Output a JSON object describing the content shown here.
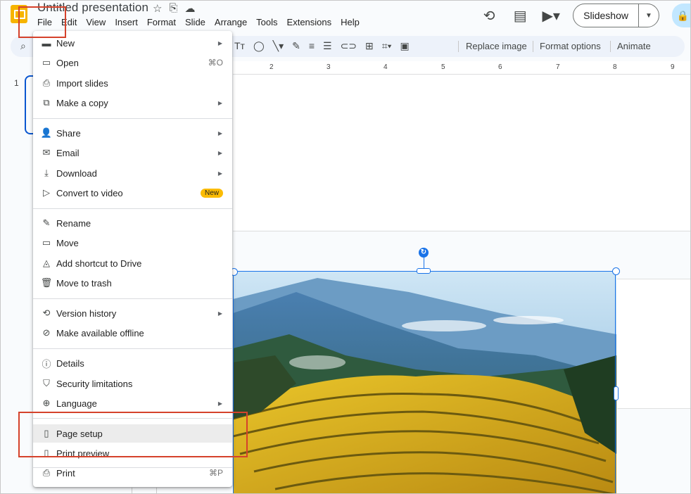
{
  "app": {
    "doc_title": "Untitled presentation",
    "title_icons": [
      "star-icon",
      "move-to-folder-icon",
      "cloud-status-icon"
    ]
  },
  "menubar": [
    "File",
    "Edit",
    "View",
    "Insert",
    "Format",
    "Slide",
    "Arrange",
    "Tools",
    "Extensions",
    "Help"
  ],
  "topright": {
    "slideshow_label": "Slideshow",
    "icons": [
      "history-icon",
      "comments-icon",
      "meet-icon"
    ]
  },
  "toolbar": {
    "replace_image": "Replace image",
    "format_options": "Format options",
    "animate": "Animate"
  },
  "ruler": [
    "2",
    "3",
    "4",
    "5",
    "6",
    "7",
    "8",
    "9"
  ],
  "filmstrip": {
    "slide_number": "1"
  },
  "file_menu": {
    "items": [
      {
        "label": "New",
        "icon": "new-slides-icon",
        "submenu": true
      },
      {
        "label": "Open",
        "icon": "folder-icon",
        "shortcut": "⌘O"
      },
      {
        "label": "Import slides",
        "icon": "import-icon"
      },
      {
        "label": "Make a copy",
        "icon": "copy-icon",
        "submenu": true
      },
      {
        "label": "Share",
        "icon": "share-icon",
        "submenu": true
      },
      {
        "label": "Email",
        "icon": "email-icon",
        "submenu": true
      },
      {
        "label": "Download",
        "icon": "download-icon",
        "submenu": true
      },
      {
        "label": "Convert to video",
        "icon": "video-icon",
        "badge": "New"
      },
      {
        "label": "Rename",
        "icon": "pencil-icon"
      },
      {
        "label": "Move",
        "icon": "folder-move-icon"
      },
      {
        "label": "Add shortcut to Drive",
        "icon": "drive-shortcut-icon"
      },
      {
        "label": "Move to trash",
        "icon": "trash-icon"
      },
      {
        "label": "Version history",
        "icon": "history-icon",
        "submenu": true
      },
      {
        "label": "Make available offline",
        "icon": "offline-icon"
      },
      {
        "label": "Details",
        "icon": "info-icon"
      },
      {
        "label": "Security limitations",
        "icon": "security-icon"
      },
      {
        "label": "Language",
        "icon": "globe-icon",
        "submenu": true
      },
      {
        "label": "Page setup",
        "icon": "page-icon",
        "highlighted": true
      },
      {
        "label": "Print preview",
        "icon": "print-preview-icon"
      },
      {
        "label": "Print",
        "icon": "print-icon",
        "shortcut": "⌘P"
      }
    ]
  },
  "colors": {
    "accent": "#0b57d0",
    "selection": "#1a73e8",
    "annotation": "#d5422b",
    "badge": "#fbbc04",
    "logo": "#f6b400"
  }
}
